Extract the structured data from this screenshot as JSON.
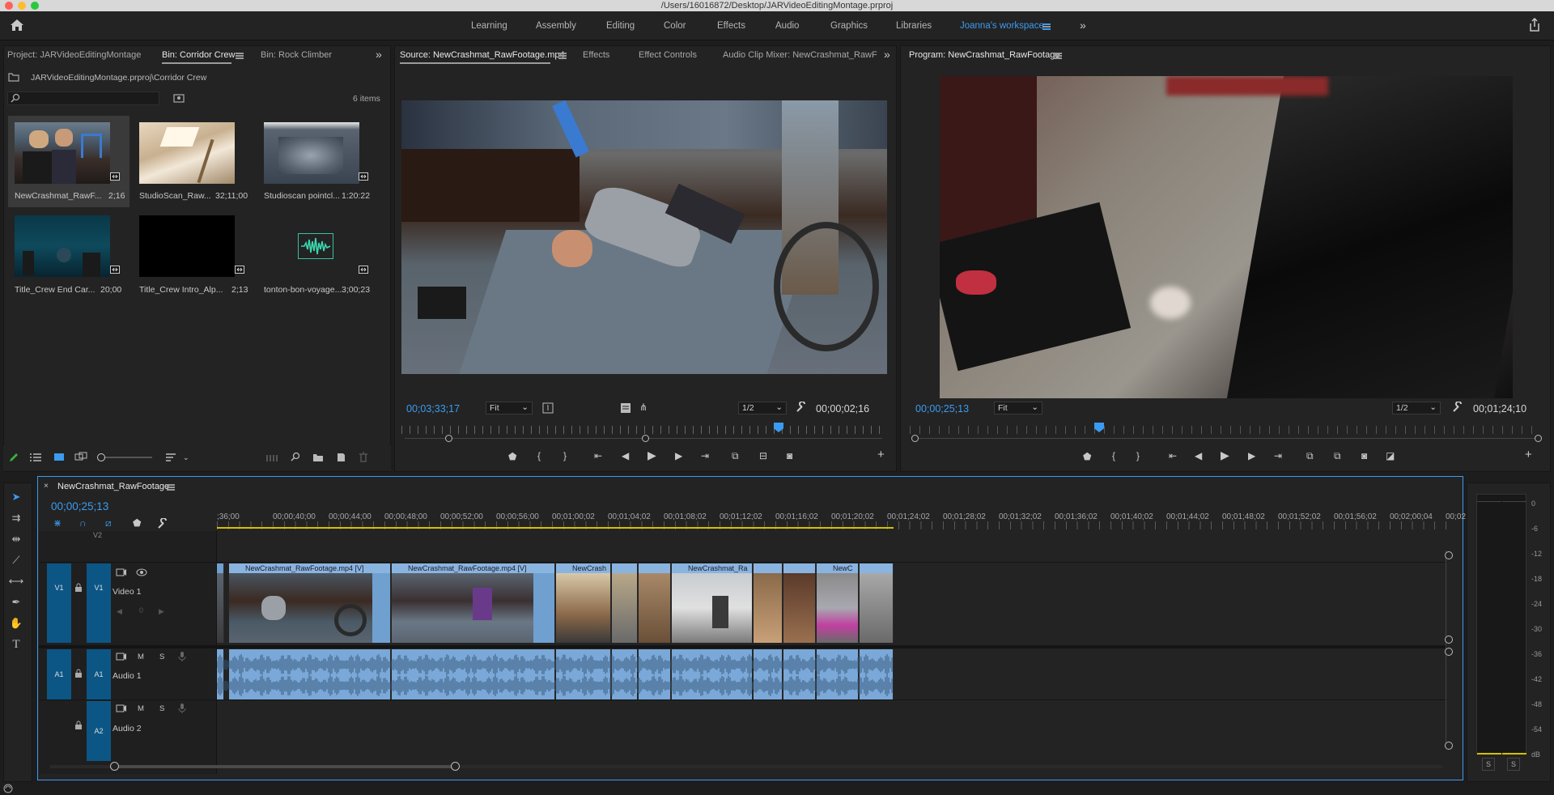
{
  "window": {
    "title": "/Users/16016872/Desktop/JARVideoEditingMontage.prproj"
  },
  "workspaces": [
    "Learning",
    "Assembly",
    "Editing",
    "Color",
    "Effects",
    "Audio",
    "Graphics",
    "Libraries",
    "Joanna's workspace"
  ],
  "project_panel": {
    "tabs": [
      "Project: JARVideoEditingMontage",
      "Bin: Corridor Crew",
      "Bin: Rock Climber"
    ],
    "path": "JARVideoEditingMontage.prproj\\Corridor Crew",
    "search_placeholder": "",
    "count": "6 items",
    "items": [
      {
        "name": "NewCrashmat_RawF...",
        "duration": "2;16"
      },
      {
        "name": "StudioScan_Raw...",
        "duration": "32;11;00"
      },
      {
        "name": "Studioscan pointcl...",
        "duration": "1:20:22"
      },
      {
        "name": "Title_Crew End Car...",
        "duration": "20;00"
      },
      {
        "name": "Title_Crew Intro_Alp...",
        "duration": "2;13"
      },
      {
        "name": "tonton-bon-voyage...",
        "duration": "3;00;23"
      }
    ]
  },
  "source_panel": {
    "tabs": [
      "Source: NewCrashmat_RawFootage.mp4",
      "Effects",
      "Effect Controls",
      "Audio Clip Mixer: NewCrashmat_RawF"
    ],
    "timecode": "00;03;33;17",
    "fit": "Fit",
    "resolution": "1/2",
    "duration": "00;00;02;16"
  },
  "program_panel": {
    "title": "Program: NewCrashmat_RawFootage",
    "timecode": "00;00;25;13",
    "fit": "Fit",
    "resolution": "1/2",
    "duration": "00;01;24;10"
  },
  "timeline": {
    "sequence": "NewCrashmat_RawFootage",
    "timecode": "00;00;25;13",
    "ruler": ";36;00|00;00;40;00|00;00;44;00|00;00;48;00|00;00;52;00|00;00;56;00|00;01;00;02|00;01;04;02|00;01;08;02|00;01;12;02|00;01;16;02|00;01;20;02|00;01;24;02|00;01;28;02|00;01;32;02|00;01;36;02|00;01;40;02|00;01;44;02|00;01;48;02|00;01;52;02|00;01;56;02|00;02;00;04|00;02",
    "tracks": {
      "v2": "V2",
      "v1": {
        "id": "V1",
        "src": "V1",
        "name": "Video 1",
        "zero": "0"
      },
      "a1": {
        "id": "A1",
        "src": "A1",
        "name": "Audio 1",
        "m": "M",
        "s": "S"
      },
      "a2": {
        "id": "A2",
        "name": "Audio 2",
        "m": "M",
        "s": "S"
      }
    },
    "clips": [
      "NewCrashmat_RawFootage.mp4 [V]",
      "NewCrashmat_RawFootage.mp4 [V]",
      "NewCrash",
      "NewCrashmat_Ra",
      "NewC"
    ]
  },
  "meter": {
    "labels": [
      "0",
      "-6",
      "-12",
      "-18",
      "-24",
      "-30",
      "-36",
      "-42",
      "-48",
      "-54",
      "dB"
    ],
    "s1": "S",
    "s2": "S"
  },
  "colors": {
    "accent": "#3b9bf0",
    "panel": "#232323",
    "track": "#0c5686",
    "clip": "#6fa0d0"
  }
}
